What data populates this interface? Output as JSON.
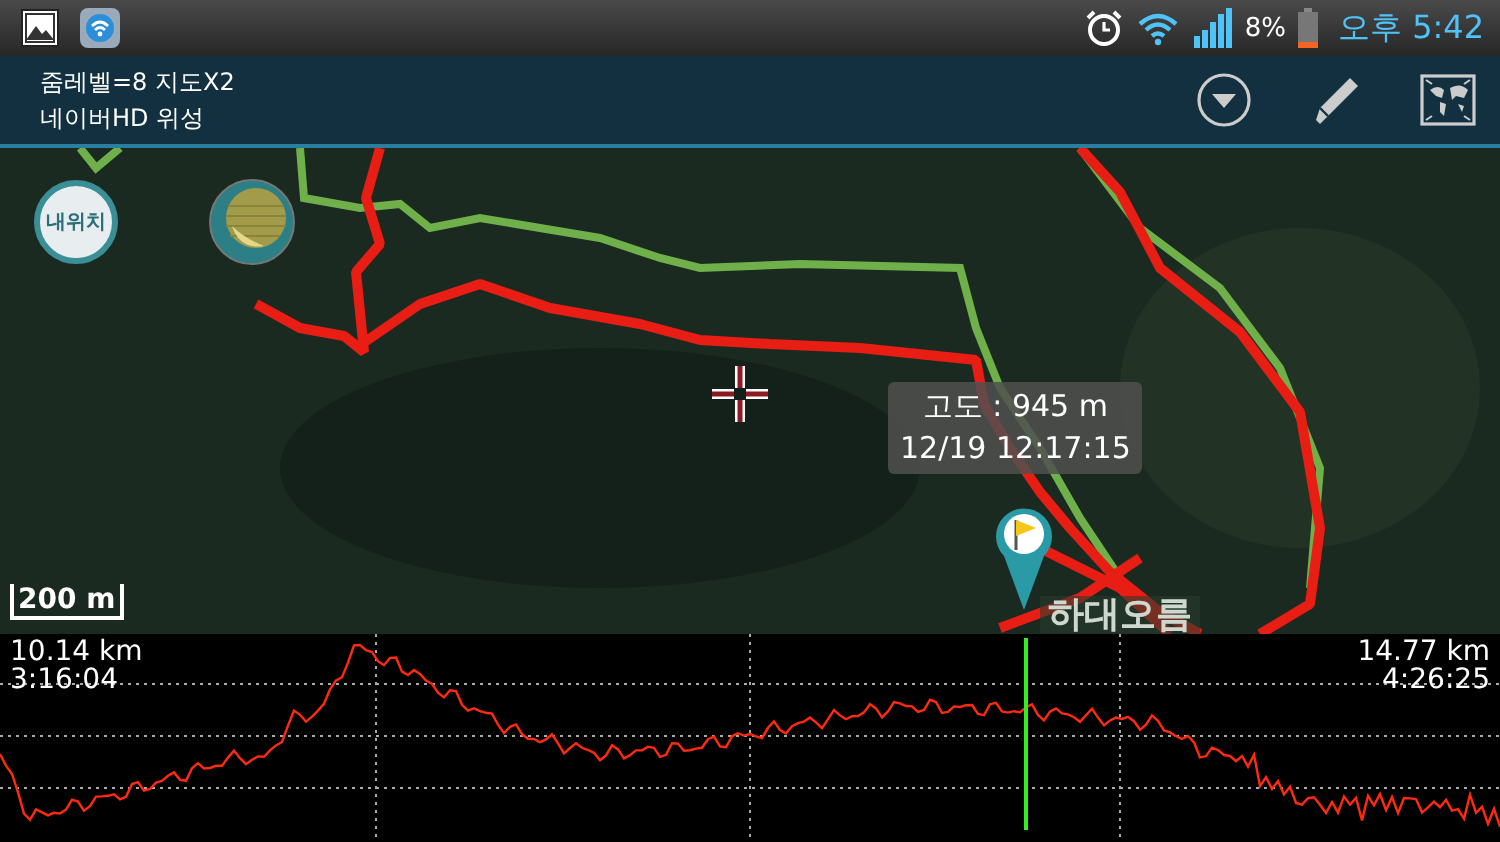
{
  "status_bar": {
    "battery": "8%",
    "time": "오후 5:42"
  },
  "toolbar": {
    "line_1": "줌레벨=8 지도X2",
    "line_2": "네이버HD 위성"
  },
  "map": {
    "my_location_button": "내위치",
    "tooltip": {
      "altitude": "고도 : 945 m",
      "time": "12/19 12:17:15"
    },
    "place_label": "하대오름",
    "scale": "200 m"
  },
  "profile": {
    "start_distance": "10.14 km",
    "start_time": "3:16:04",
    "end_distance": "14.77 km",
    "end_time": "4:26:25"
  }
}
